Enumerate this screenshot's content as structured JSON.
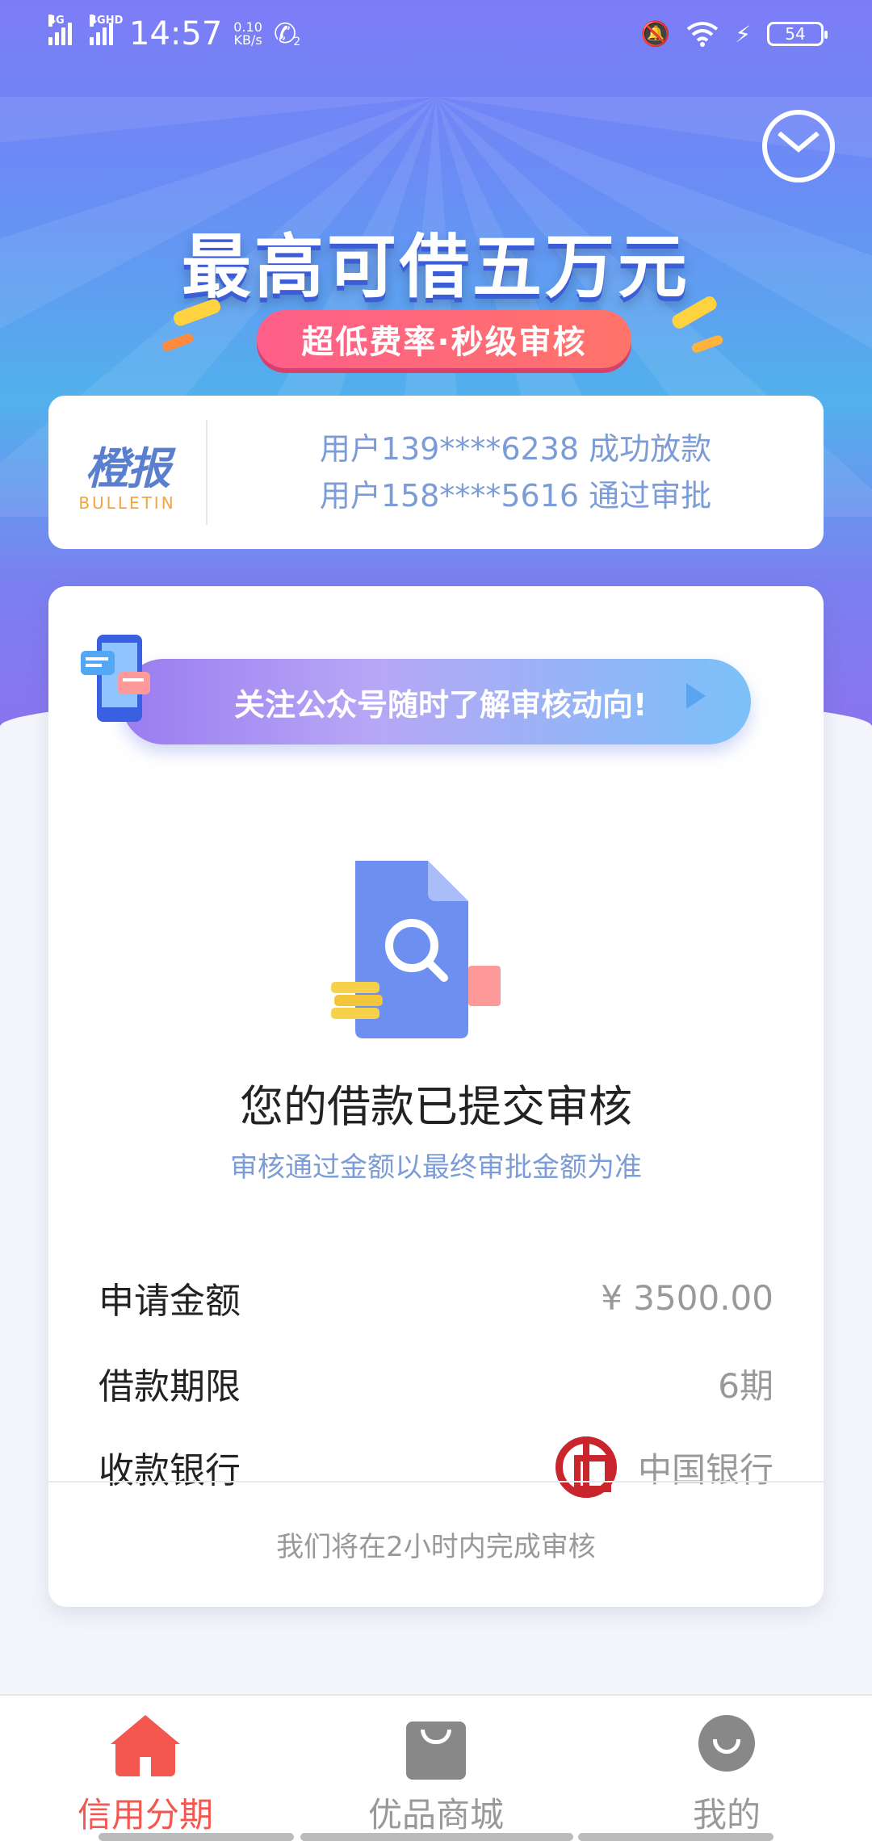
{
  "status_bar": {
    "network1": "4G",
    "network2": "4GHD",
    "time": "14:57",
    "speed_value": "0.10",
    "speed_unit": "KB/s",
    "call_sim": "2",
    "battery": "54"
  },
  "hero": {
    "title": "最高可借五万元",
    "pill": "超低费率·秒级审核"
  },
  "bulletin": {
    "logo_cn": "橙报",
    "logo_en": "BULLETIN",
    "lines": [
      "用户139****6238 成功放款",
      "用户158****5616 通过审批"
    ]
  },
  "follow_banner": {
    "text": "关注公众号随时了解审核动向!"
  },
  "status": {
    "title": "您的借款已提交审核",
    "subtitle": "审核通过金额以最终审批金额为准"
  },
  "details": [
    {
      "label": "申请金额",
      "value": "¥ 3500.00"
    },
    {
      "label": "借款期限",
      "value": "6期"
    },
    {
      "label": "收款银行",
      "value": "中国银行"
    }
  ],
  "footer_note": "我们将在2小时内完成审核",
  "bottom_nav": [
    {
      "label": "信用分期",
      "icon": "home-icon",
      "active": true
    },
    {
      "label": "优品商城",
      "icon": "shopping-bag-icon",
      "active": false
    },
    {
      "label": "我的",
      "icon": "profile-icon",
      "active": false
    }
  ],
  "colors": {
    "accent": "#f4574f",
    "link_blue": "#7b9cd6",
    "bank_red": "#c8252c"
  }
}
